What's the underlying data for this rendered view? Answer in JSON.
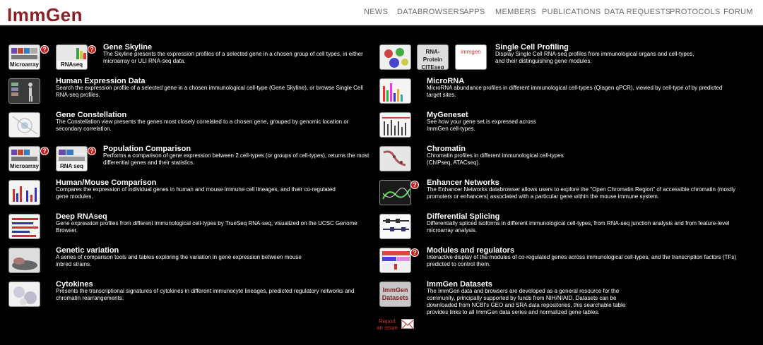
{
  "header": {
    "logo": "ImmGen",
    "nav": [
      "NEWS",
      "DATABROWSERS",
      "APPS",
      "MEMBERS",
      "PUBLICATIONS",
      "DATA REQUESTS",
      "PROTOCOLS",
      "FORUM"
    ]
  },
  "left": [
    {
      "title": "Gene Skyline",
      "desc": "The Skyline presents the expression profiles of a selected gene in a chosen group of cell types, in either microarray or ULI RNA-seq data.",
      "thumbs": [
        "Microarray",
        "RNAseq"
      ]
    },
    {
      "title": "Human Expression Data",
      "desc": "Search the expression profile of a selected gene in a chosen immunological cell-type (Gene Skyline), or browse Single Cell RNA-seq profiles.",
      "thumbs": [
        ""
      ]
    },
    {
      "title": "Gene Constellation",
      "desc": "The Constellation view presents the genes most closely correlated to a chosen gene, grouped by genomic location or secondary correlation.",
      "thumbs": [
        ""
      ]
    },
    {
      "title": "Population Comparison",
      "desc": "Performs a comparison of gene expression between 2 cell-types (or groups of cell-types), returns the most differential genes and their statistics.",
      "thumbs": [
        "Microarray",
        "RNA seq"
      ]
    },
    {
      "title": "Human/Mouse Comparison",
      "desc": "Compares the expression of individual genes in human and mouse immune cell lineages, and their co-regulated gene modules.",
      "thumbs": [
        ""
      ]
    },
    {
      "title": "Deep RNAseq",
      "desc": "Gene expression profiles from different immunological cell-types by TrueSeq RNA-seq, visualized on the UCSC Genome Browser.",
      "thumbs": [
        ""
      ]
    },
    {
      "title": "Genetic variation",
      "desc": "A series of comparison tools and tables exploring the variation in gene expression between mouse inbred strains.",
      "thumbs": [
        ""
      ]
    },
    {
      "title": "Cytokines",
      "desc": "Presents the transcriptional signatures of cytokines in different immunocyte lineages, predicted regulatory networks and chromatin rearrangements.",
      "thumbs": [
        ""
      ]
    }
  ],
  "right": [
    {
      "title": "Single Cell Profiling",
      "desc": "Display Single Cell RNA-seq profiles from immunological organs and cell-types, and their distinguishing gene modules.",
      "thumbs": [
        "",
        "RNA-Protein CITEseq",
        "immgen"
      ]
    },
    {
      "title": "MicroRNA",
      "desc": "MicroRNA abundance profiles in different immunological cell-types (Qiagen qPCR), viewed by cell-type of by predicted target sites.",
      "thumbs": [
        ""
      ]
    },
    {
      "title": "MyGeneset",
      "desc": "See how your gene set is expressed across ImmGen cell-types.",
      "thumbs": [
        ""
      ]
    },
    {
      "title": "Chromatin",
      "desc": "Chromatin profiles in different immunological cell-types (ChIPseq, ATACseq).",
      "thumbs": [
        ""
      ]
    },
    {
      "title": "Enhancer Networks",
      "desc": "The Enhancer Networks databrowser allows users to explore the \"Open Chromatin Region\" of accessible chromatin (mostly promoters or enhancers) associated with a particular gene within the mouse immune system.",
      "thumbs": [
        ""
      ]
    },
    {
      "title": "Differential Splicing",
      "desc": "Differentially spliced isoforms in different immunological cell-types, from RNA-seq junction analysis and from feature-level microarray analysis.",
      "thumbs": [
        ""
      ]
    },
    {
      "title": "Modules and regulators",
      "desc": "Interactive display of the modules of co-regulated genes across immunological cell-types, and the transcription factors (TFs) predicted to control them.",
      "thumbs": [
        ""
      ]
    },
    {
      "title": "ImmGen Datasets",
      "desc": "The ImmGen data and browsers are developed as a general resource for the community, principally supported by funds from NIH/NIAID. Datasets can be downloaded from NCBI's GEO and SRA data repositories, this searchable table provides links to all ImmGen data series and normalized gene tables.",
      "thumbs": [
        "ImmGen Datasets"
      ]
    }
  ],
  "help_glyph": "?",
  "report": "Report an issue"
}
